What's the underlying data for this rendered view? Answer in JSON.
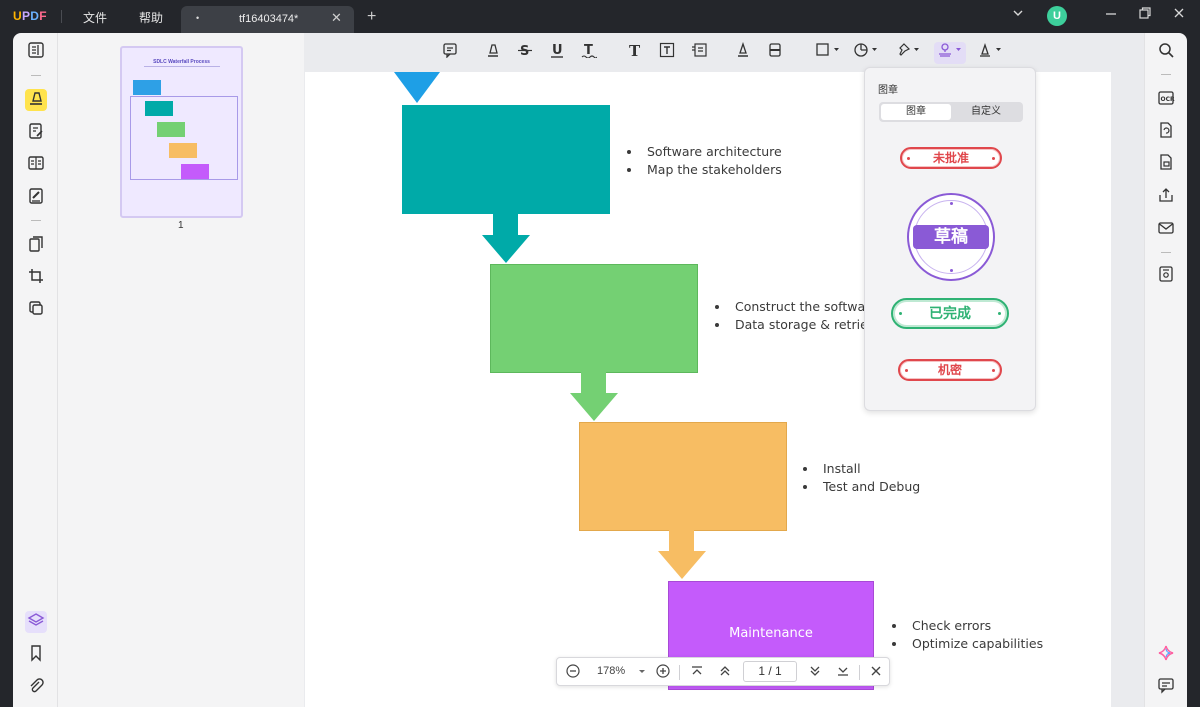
{
  "app": {
    "logo": {
      "a": "U",
      "b": "P",
      "c": "D",
      "d": "F"
    }
  },
  "menu": {
    "file": "文件",
    "help": "帮助"
  },
  "tab": {
    "dot": "•",
    "name": "tf16403474*",
    "close": "✕",
    "new": "+"
  },
  "avatar": "U",
  "thumbnail": {
    "title": "SDLC Waterfall Process",
    "page_number": "1"
  },
  "flowchart": {
    "blocks": [
      {
        "color": "#00aaa8",
        "bullets": [
          "Software architecture",
          "Map the stakeholders"
        ]
      },
      {
        "color": "#74d073",
        "bullets": [
          "Construct the software",
          "Data storage & retrieval"
        ]
      },
      {
        "color": "#f7bd63",
        "bullets": [
          "Install",
          "Test and Debug"
        ]
      },
      {
        "color": "#c45bfb",
        "label": "Maintenance",
        "bullets": [
          "Check errors",
          "Optimize capabilities"
        ]
      }
    ]
  },
  "stamp_panel": {
    "title": "图章",
    "tabs": [
      "图章",
      "自定义"
    ],
    "stamps": [
      {
        "label": "未批准",
        "color": "#e0474c"
      },
      {
        "label": "草稿",
        "color": "#8a5ad6"
      },
      {
        "label": "已完成",
        "color": "#2fb274"
      },
      {
        "label": "机密",
        "color": "#e0474c"
      }
    ]
  },
  "zoom": {
    "level": "178%",
    "page": "1 / 1"
  },
  "colors": {
    "accent": "#8a5ad6",
    "avatar": "#3dcf9b"
  }
}
